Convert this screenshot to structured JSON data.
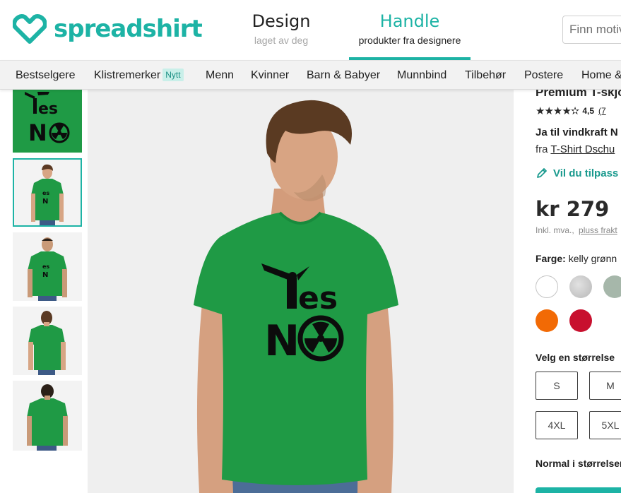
{
  "header": {
    "logo_text": "spreadshirt",
    "tabs": [
      {
        "title": "Design",
        "subtitle": "laget av deg"
      },
      {
        "title": "Handle",
        "subtitle": "produkter fra designere"
      }
    ],
    "search_placeholder": "Finn motiv"
  },
  "categories": [
    {
      "label": "Bestselgere"
    },
    {
      "label": "Klistremerker",
      "badge": "Nytt"
    },
    {
      "label": "Menn"
    },
    {
      "label": "Kvinner"
    },
    {
      "label": "Barn & Babyer"
    },
    {
      "label": "Munnbind"
    },
    {
      "label": "Tilbehør"
    },
    {
      "label": "Postere"
    },
    {
      "label": "Home &"
    }
  ],
  "design": {
    "line1": "es",
    "line2": "N",
    "color": "#0c0c0c"
  },
  "thumbnails": [
    {
      "view": "design-closeup"
    },
    {
      "view": "front"
    },
    {
      "view": "front-plus"
    },
    {
      "view": "back"
    },
    {
      "view": "back-plus"
    }
  ],
  "product": {
    "title": "Premium T-skjo",
    "rating_value": "4,5",
    "rating_count": "(7",
    "stars": "★★★★✫",
    "design_name": "Ja til vindkraft N",
    "by_prefix": "fra",
    "designer": "T-Shirt Dschu",
    "customize": "Vil du tilpass",
    "price": "kr 279",
    "vat_text": "Inkl. mva.,",
    "shipping_link": "pluss frakt",
    "color_label": "Farge:",
    "color_value": "kelly grønn",
    "size_heading": "Velg en størrelse",
    "sizes": [
      "S",
      "M",
      "4XL",
      "5XL"
    ],
    "fit_note": "Normal i størrelser"
  },
  "colors": {
    "brand": "#1db3a5",
    "shirt": "#1f9a45",
    "swatches": [
      "#ffffff",
      "#c8c8c8",
      "#a6b7aa",
      "#f26a05",
      "#c8102e"
    ]
  }
}
